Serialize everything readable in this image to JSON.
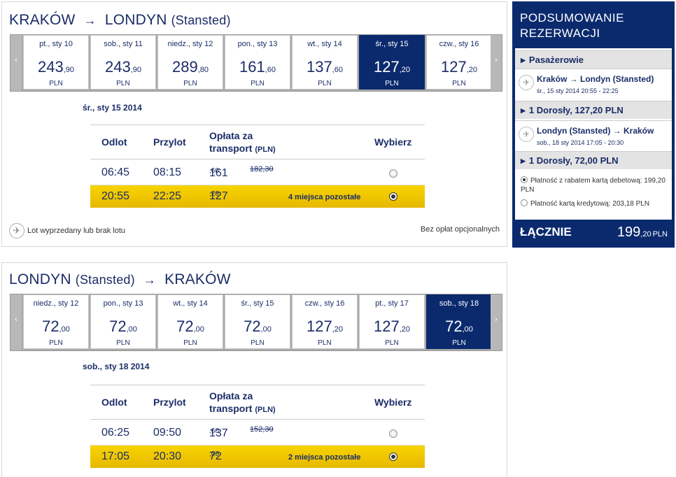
{
  "outbound": {
    "from": "KRAKÓW",
    "arrow": "→",
    "to": "LONDYN",
    "to_sub": "(Stansted)",
    "dates": [
      {
        "label": "pt., sty 10",
        "int": "243",
        "dec": ",90",
        "cur": "PLN",
        "selected": false
      },
      {
        "label": "sob., sty 11",
        "int": "243",
        "dec": ",90",
        "cur": "PLN",
        "selected": false
      },
      {
        "label": "niedz., sty 12",
        "int": "289",
        "dec": ",80",
        "cur": "PLN",
        "selected": false
      },
      {
        "label": "pon., sty 13",
        "int": "161",
        "dec": ",60",
        "cur": "PLN",
        "selected": false
      },
      {
        "label": "wt., sty 14",
        "int": "137",
        "dec": ",60",
        "cur": "PLN",
        "selected": false
      },
      {
        "label": "śr., sty 15",
        "int": "127",
        "dec": ",20",
        "cur": "PLN",
        "selected": true
      },
      {
        "label": "czw., sty 16",
        "int": "127",
        "dec": ",20",
        "cur": "PLN",
        "selected": false
      }
    ],
    "selected_date": "śr., sty 15 2014",
    "headers": {
      "dep": "Odlot",
      "arr": "Przylot",
      "fee_line1": "Opłata za",
      "fee_line2": "transport",
      "fee_unit": "(PLN)",
      "select": "Wybierz"
    },
    "flights": [
      {
        "dep": "06:45",
        "arr": "08:15",
        "int": "161",
        "dec": ",60",
        "old": "182,30",
        "seats": "",
        "selected": false
      },
      {
        "dep": "20:55",
        "arr": "22:25",
        "int": "127",
        "dec": ",20",
        "old": "",
        "seats": "4 miejsca pozostałe",
        "selected": true
      }
    ],
    "legend": "Lot wyprzedany lub brak lotu",
    "no_fees": "Bez opłat opcjonalnych"
  },
  "return": {
    "from": "LONDYN",
    "from_sub": "(Stansted)",
    "arrow": "→",
    "to": "KRAKÓW",
    "dates": [
      {
        "label": "niedz., sty 12",
        "int": "72",
        "dec": ",00",
        "cur": "PLN",
        "selected": false
      },
      {
        "label": "pon., sty 13",
        "int": "72",
        "dec": ",00",
        "cur": "PLN",
        "selected": false
      },
      {
        "label": "wt., sty 14",
        "int": "72",
        "dec": ",00",
        "cur": "PLN",
        "selected": false
      },
      {
        "label": "śr., sty 15",
        "int": "72",
        "dec": ",00",
        "cur": "PLN",
        "selected": false
      },
      {
        "label": "czw., sty 16",
        "int": "127",
        "dec": ",20",
        "cur": "PLN",
        "selected": false
      },
      {
        "label": "pt., sty 17",
        "int": "127",
        "dec": ",20",
        "cur": "PLN",
        "selected": false
      },
      {
        "label": "sob., sty 18",
        "int": "72",
        "dec": ",00",
        "cur": "PLN",
        "selected": true
      }
    ],
    "selected_date": "sob., sty 18 2014",
    "headers": {
      "dep": "Odlot",
      "arr": "Przylot",
      "fee_line1": "Opłata za",
      "fee_line2": "transport",
      "fee_unit": "(PLN)",
      "select": "Wybierz"
    },
    "flights": [
      {
        "dep": "06:25",
        "arr": "09:50",
        "int": "137",
        "dec": ",60",
        "old": "152,30",
        "seats": "",
        "selected": false
      },
      {
        "dep": "17:05",
        "arr": "20:30",
        "int": "72",
        "dec": ",00",
        "old": "",
        "seats": "2 miejsca pozostałe",
        "selected": true
      }
    ]
  },
  "summary": {
    "title_line1": "PODSUMOWANIE",
    "title_line2": "REZERWACJI",
    "passengers": "Pasażerowie",
    "flight1_route": "Kraków → Londyn (Stansted)",
    "flight1_when": "śr., 15 sty 2014 20:55 - 22:25",
    "flight1_fare": "1 Dorosły, 127,20 PLN",
    "flight2_route": "Londyn (Stansted) → Kraków",
    "flight2_when": "sob., 18 sty 2014 17:05 - 20:30",
    "flight2_fare": "1 Dorosły, 72,00 PLN",
    "pay_debit": "Płatność z rabatem kartą debetową: 199,20 PLN",
    "pay_credit": "Płatność kartą kredytową: 203,18 PLN",
    "total_label": "ŁĄCZNIE",
    "total_int": "199",
    "total_dec": ",20",
    "total_cur": "PLN"
  },
  "icons": {
    "prev": "‹",
    "next": "›",
    "plane": "✈",
    "triangle": "▶"
  },
  "colors": {
    "navy": "#0b2a6e",
    "highlight": "#f2c900",
    "text": "#1b2d68"
  }
}
